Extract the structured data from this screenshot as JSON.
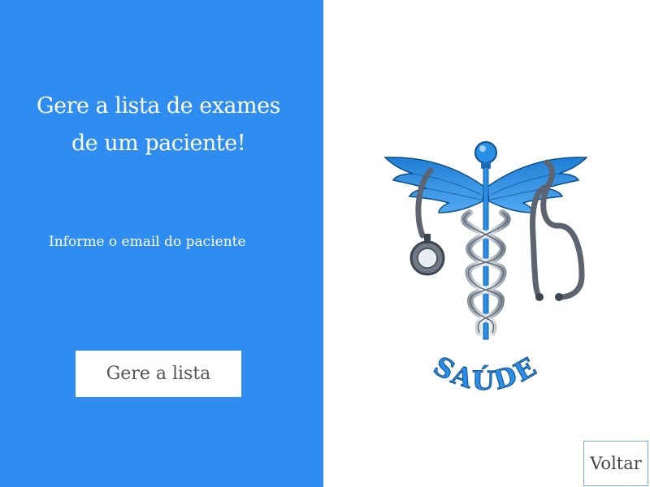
{
  "heading": {
    "line1": "Gere a lista de exames",
    "line2": "de um paciente!"
  },
  "form": {
    "email_label": "Informe o email do paciente",
    "email_value": "",
    "submit_label": "Gere a lista"
  },
  "logo": {
    "text": "SAÚDE",
    "icon": "caduceus-stethoscope-icon"
  },
  "nav": {
    "back_label": "Voltar"
  },
  "colors": {
    "panel_blue": "#2f8cf0",
    "logo_blue": "#2a8ee6",
    "button_text": "#555555"
  }
}
